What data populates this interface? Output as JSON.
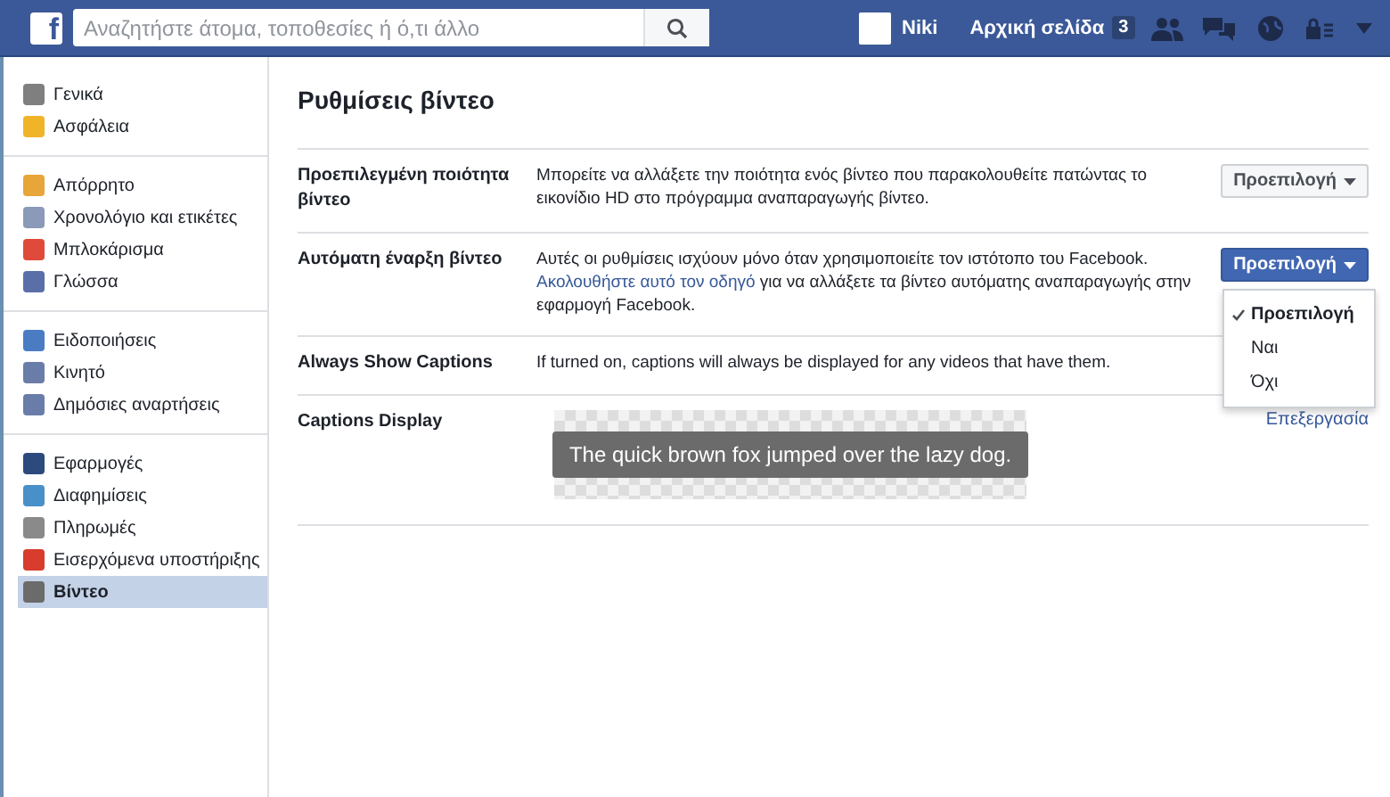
{
  "header": {
    "logo": "f",
    "search": {
      "placeholder": "Αναζητήστε άτομα, τοποθεσίες ή ό,τι άλλο"
    },
    "profile_name": "Niki",
    "home": {
      "label": "Αρχική σελίδα",
      "badge": "3"
    }
  },
  "sidebar": {
    "groups": [
      {
        "items": [
          {
            "label": "Γενικά",
            "selected": false
          },
          {
            "label": "Ασφάλεια",
            "selected": false
          }
        ]
      },
      {
        "items": [
          {
            "label": "Απόρρητο",
            "selected": false
          },
          {
            "label": "Χρονολόγιο και ετικέτες",
            "selected": false
          },
          {
            "label": "Μπλοκάρισμα",
            "selected": false
          },
          {
            "label": "Γλώσσα",
            "selected": false
          }
        ]
      },
      {
        "items": [
          {
            "label": "Ειδοποιήσεις",
            "selected": false
          },
          {
            "label": "Κινητό",
            "selected": false
          },
          {
            "label": "Δημόσιες αναρτήσεις",
            "selected": false
          }
        ]
      },
      {
        "items": [
          {
            "label": "Εφαρμογές",
            "selected": false
          },
          {
            "label": "Διαφημίσεις",
            "selected": false
          },
          {
            "label": "Πληρωμές",
            "selected": false
          },
          {
            "label": "Εισερχόμενα υποστήριξης",
            "selected": false
          },
          {
            "label": "Βίντεο",
            "selected": true
          }
        ]
      }
    ]
  },
  "title": "Ρυθμίσεις βίντεο",
  "settings": [
    {
      "kind": "dropdown",
      "label": "Προεπιλεγμένη ποιότητα βίντεο",
      "description": "Μπορείτε να αλλάξετε την ποιότητα ενός βίντεο που παρακολουθείτε πατώντας το εικονίδιο HD στο πρόγραμμα αναπαραγωγής βίντεο.",
      "value": "Προεπιλογή",
      "expanded": false
    },
    {
      "kind": "dropdown",
      "label": "Αυτόματη έναρξη βίντεο",
      "description": "Αυτές οι ρυθμίσεις ισχύουν μόνο όταν χρησιμοποιείτε τον ιστότοπο του Facebook.",
      "link": "Ακολουθήστε αυτό τον οδηγό",
      "description_after_link": "για να αλλάξετε τα βίντεο αυτόματης αναπαραγωγής στην εφαρμογή Facebook.",
      "value": "Προεπιλογή",
      "expanded": true,
      "options": [
        {
          "label": "Προεπιλογή",
          "selected": true
        },
        {
          "label": "Ναι",
          "selected": false
        },
        {
          "label": "Όχι",
          "selected": false
        }
      ]
    },
    {
      "kind": "text",
      "label": "Always Show Captions",
      "description": "If turned on, captions will always be displayed for any videos that have them."
    },
    {
      "kind": "caption-preview",
      "label": "Captions Display",
      "caption": "The quick brown fox jumped over the lazy dog.",
      "action": "Επεξεργασία"
    }
  ]
}
